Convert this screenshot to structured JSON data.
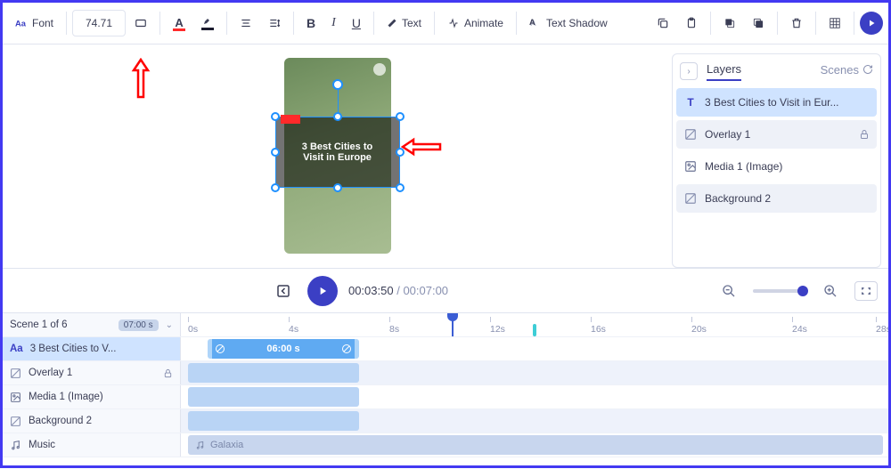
{
  "toolbar": {
    "font_label": "Font",
    "font_size": "74.71",
    "text_label": "Text",
    "animate_label": "Animate",
    "shadow_label": "Text Shadow"
  },
  "canvas": {
    "text_line1": "3 Best Cities to",
    "text_line2": "Visit in Europe"
  },
  "layers": {
    "tab_layers": "Layers",
    "tab_scenes": "Scenes",
    "items": [
      {
        "label": "3 Best Cities to Visit in Eur...",
        "icon": "text",
        "selected": true
      },
      {
        "label": "Overlay 1",
        "icon": "overlay",
        "locked": true
      },
      {
        "label": "Media 1 (Image)",
        "icon": "image"
      },
      {
        "label": "Background 2",
        "icon": "overlay"
      }
    ]
  },
  "playback": {
    "current": "00:03:50",
    "total": "00:07:00"
  },
  "timeline": {
    "scene_label": "Scene 1 of 6",
    "scene_duration": "07:00 s",
    "ruler": [
      "0s",
      "4s",
      "8s",
      "12s",
      "16s",
      "20s",
      "24s",
      "28s"
    ],
    "tracks": [
      {
        "label": "3 Best Cities to V...",
        "icon": "text",
        "selected": true,
        "clip_label": "06:00 s"
      },
      {
        "label": "Overlay 1",
        "icon": "overlay",
        "locked": true
      },
      {
        "label": "Media 1 (Image)",
        "icon": "image"
      },
      {
        "label": "Background 2",
        "icon": "overlay"
      },
      {
        "label": "Music",
        "icon": "music",
        "music_label": "Galaxia"
      }
    ]
  }
}
